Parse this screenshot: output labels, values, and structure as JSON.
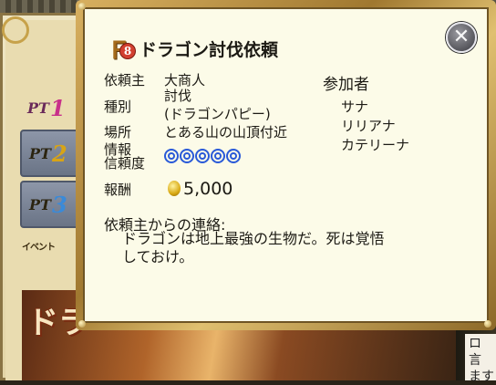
{
  "background": {
    "tabs": [
      {
        "prefix": "PT",
        "num": "1"
      },
      {
        "prefix": "PT",
        "num": "2"
      },
      {
        "prefix": "PT",
        "num": "3"
      }
    ],
    "event_label": "イベント",
    "banner_text": "ドラ",
    "side_note": "ロ 言 ます"
  },
  "quest": {
    "rank_glyph": "Ｆ",
    "rank_level": "8",
    "title": "ドラゴン討伐依頼",
    "labels": {
      "client": "依頼主",
      "type": "種別",
      "location": "場所",
      "info": "情報",
      "reliability": "信頼度",
      "reward": "報酬"
    },
    "client": "大商人",
    "type_line1": "討伐",
    "type_line2": "(ドラゴンパピー)",
    "location": "とある山の山頂付近",
    "reliability_value": 5,
    "reward": "5,000",
    "participants_label": "参加者",
    "participants": [
      "サナ",
      "リリアナ",
      "カテリーナ"
    ],
    "message_label": "依頼主からの連絡:",
    "message": "ドラゴンは地上最強の生物だ。死は覚悟しておけ。"
  },
  "colors": {
    "panel": "#fcfbe8",
    "frame_gold": "#c49a48",
    "rating_blue": "#2a5ad8"
  },
  "icons": {
    "close": "close-circle-icon",
    "coin": "gold-coin-icon",
    "rank": "rank-f-badge-icon",
    "rating": "double-ring-icon"
  }
}
